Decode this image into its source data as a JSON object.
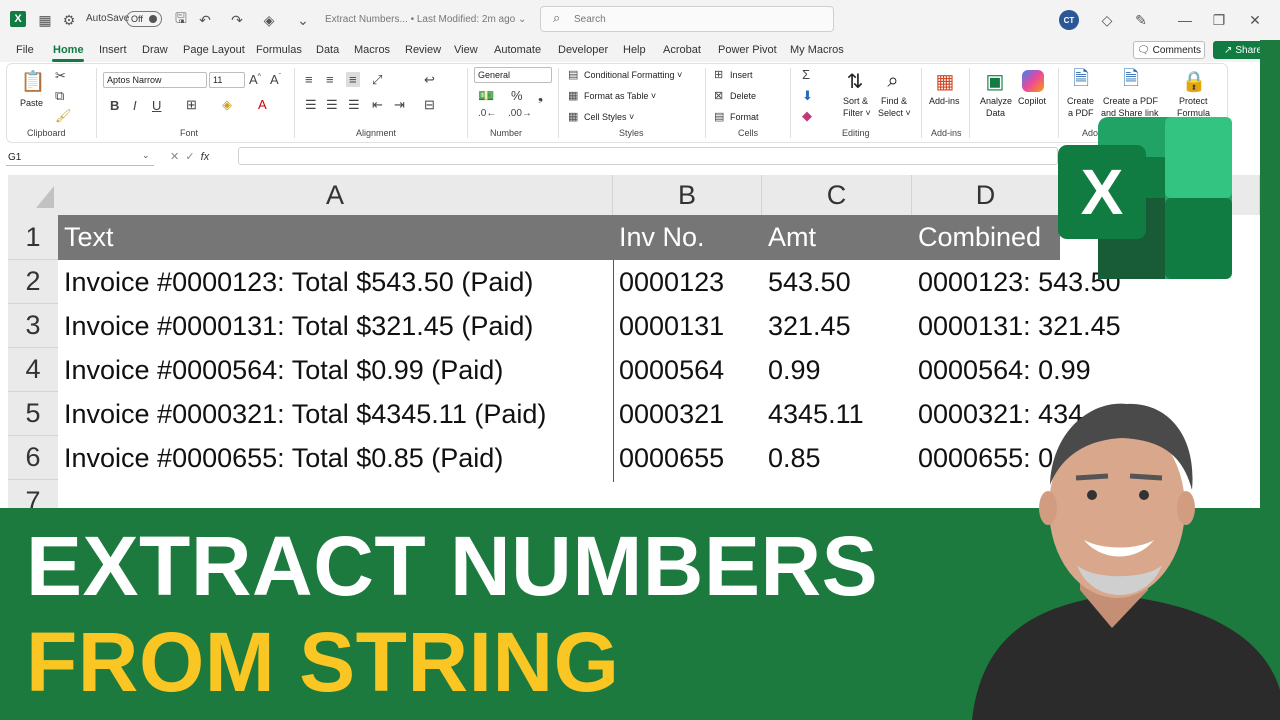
{
  "titlebar": {
    "autosave_label": "AutoSave",
    "autosave_state": "Off",
    "doc_title": "Extract Numbers... • Last Modified: 2m ago ⌄",
    "search_placeholder": "Search",
    "user_initials": "CT"
  },
  "menu": {
    "tabs": [
      "File",
      "Home",
      "Insert",
      "Draw",
      "Page Layout",
      "Formulas",
      "Data",
      "Macros",
      "Review",
      "View",
      "Automate",
      "Developer",
      "Help",
      "Acrobat",
      "Power Pivot",
      "My Macros"
    ],
    "active_tab": "Home",
    "comments_label": "Comments",
    "share_label": "Share"
  },
  "ribbon": {
    "clipboard": {
      "label": "Clipboard",
      "paste": "Paste"
    },
    "font": {
      "label": "Font",
      "font_name": "Aptos Narrow",
      "font_size": "11"
    },
    "alignment": {
      "label": "Alignment"
    },
    "number": {
      "label": "Number",
      "format": "General"
    },
    "styles": {
      "label": "Styles",
      "conditional": "Conditional Formatting ˅",
      "format_table": "Format as Table ˅",
      "cell_styles": "Cell Styles ˅"
    },
    "cells": {
      "label": "Cells",
      "insert": "Insert",
      "delete": "Delete",
      "format": "Format"
    },
    "editing": {
      "label": "Editing",
      "sort_filter_1": "Sort &",
      "sort_filter_2": "Filter ˅",
      "find_select_1": "Find &",
      "find_select_2": "Select ˅"
    },
    "addins": {
      "label": "Add-ins",
      "addins_btn": "Add-ins",
      "analyze_1": "Analyze",
      "analyze_2": "Data",
      "copilot": "Copilot"
    },
    "adobe": {
      "label": "Adob",
      "create_pdf_1": "Create",
      "create_pdf_2": "a PDF",
      "share_link_1": "Create a PDF",
      "share_link_2": "and Share link",
      "protect_1": "Protect",
      "protect_2": "Formula"
    }
  },
  "formula_bar": {
    "name_box": "G1",
    "fx": "fx",
    "value": ""
  },
  "sheet": {
    "columns": [
      "A",
      "B",
      "C",
      "D"
    ],
    "rows": [
      "1",
      "2",
      "3",
      "4",
      "5",
      "6",
      "7"
    ],
    "header": [
      "Text",
      "Inv No.",
      "Amt",
      "Combined"
    ],
    "data": [
      [
        "Invoice #0000123: Total $543.50 (Paid)",
        "0000123",
        "543.50",
        "0000123: 543.50"
      ],
      [
        "Invoice #0000131: Total $321.45 (Paid)",
        "0000131",
        "321.45",
        "0000131: 321.45"
      ],
      [
        "Invoice #0000564: Total $0.99 (Paid)",
        "0000564",
        "0.99",
        "0000564: 0.99"
      ],
      [
        "Invoice #0000321: Total $4345.11 (Paid)",
        "0000321",
        "4345.11",
        "0000321: 434"
      ],
      [
        "Invoice #0000655: Total $0.85 (Paid)",
        "0000655",
        "0.85",
        "0000655: 0."
      ]
    ]
  },
  "banner": {
    "line1": "EXTRACT NUMBERS",
    "line2": "FROM STRING"
  },
  "logo": {
    "letter": "X"
  },
  "colors": {
    "excel_green": "#107c41",
    "banner_green": "#1c7a3e",
    "banner_yellow": "#f9c623",
    "header_gray": "#767676"
  }
}
